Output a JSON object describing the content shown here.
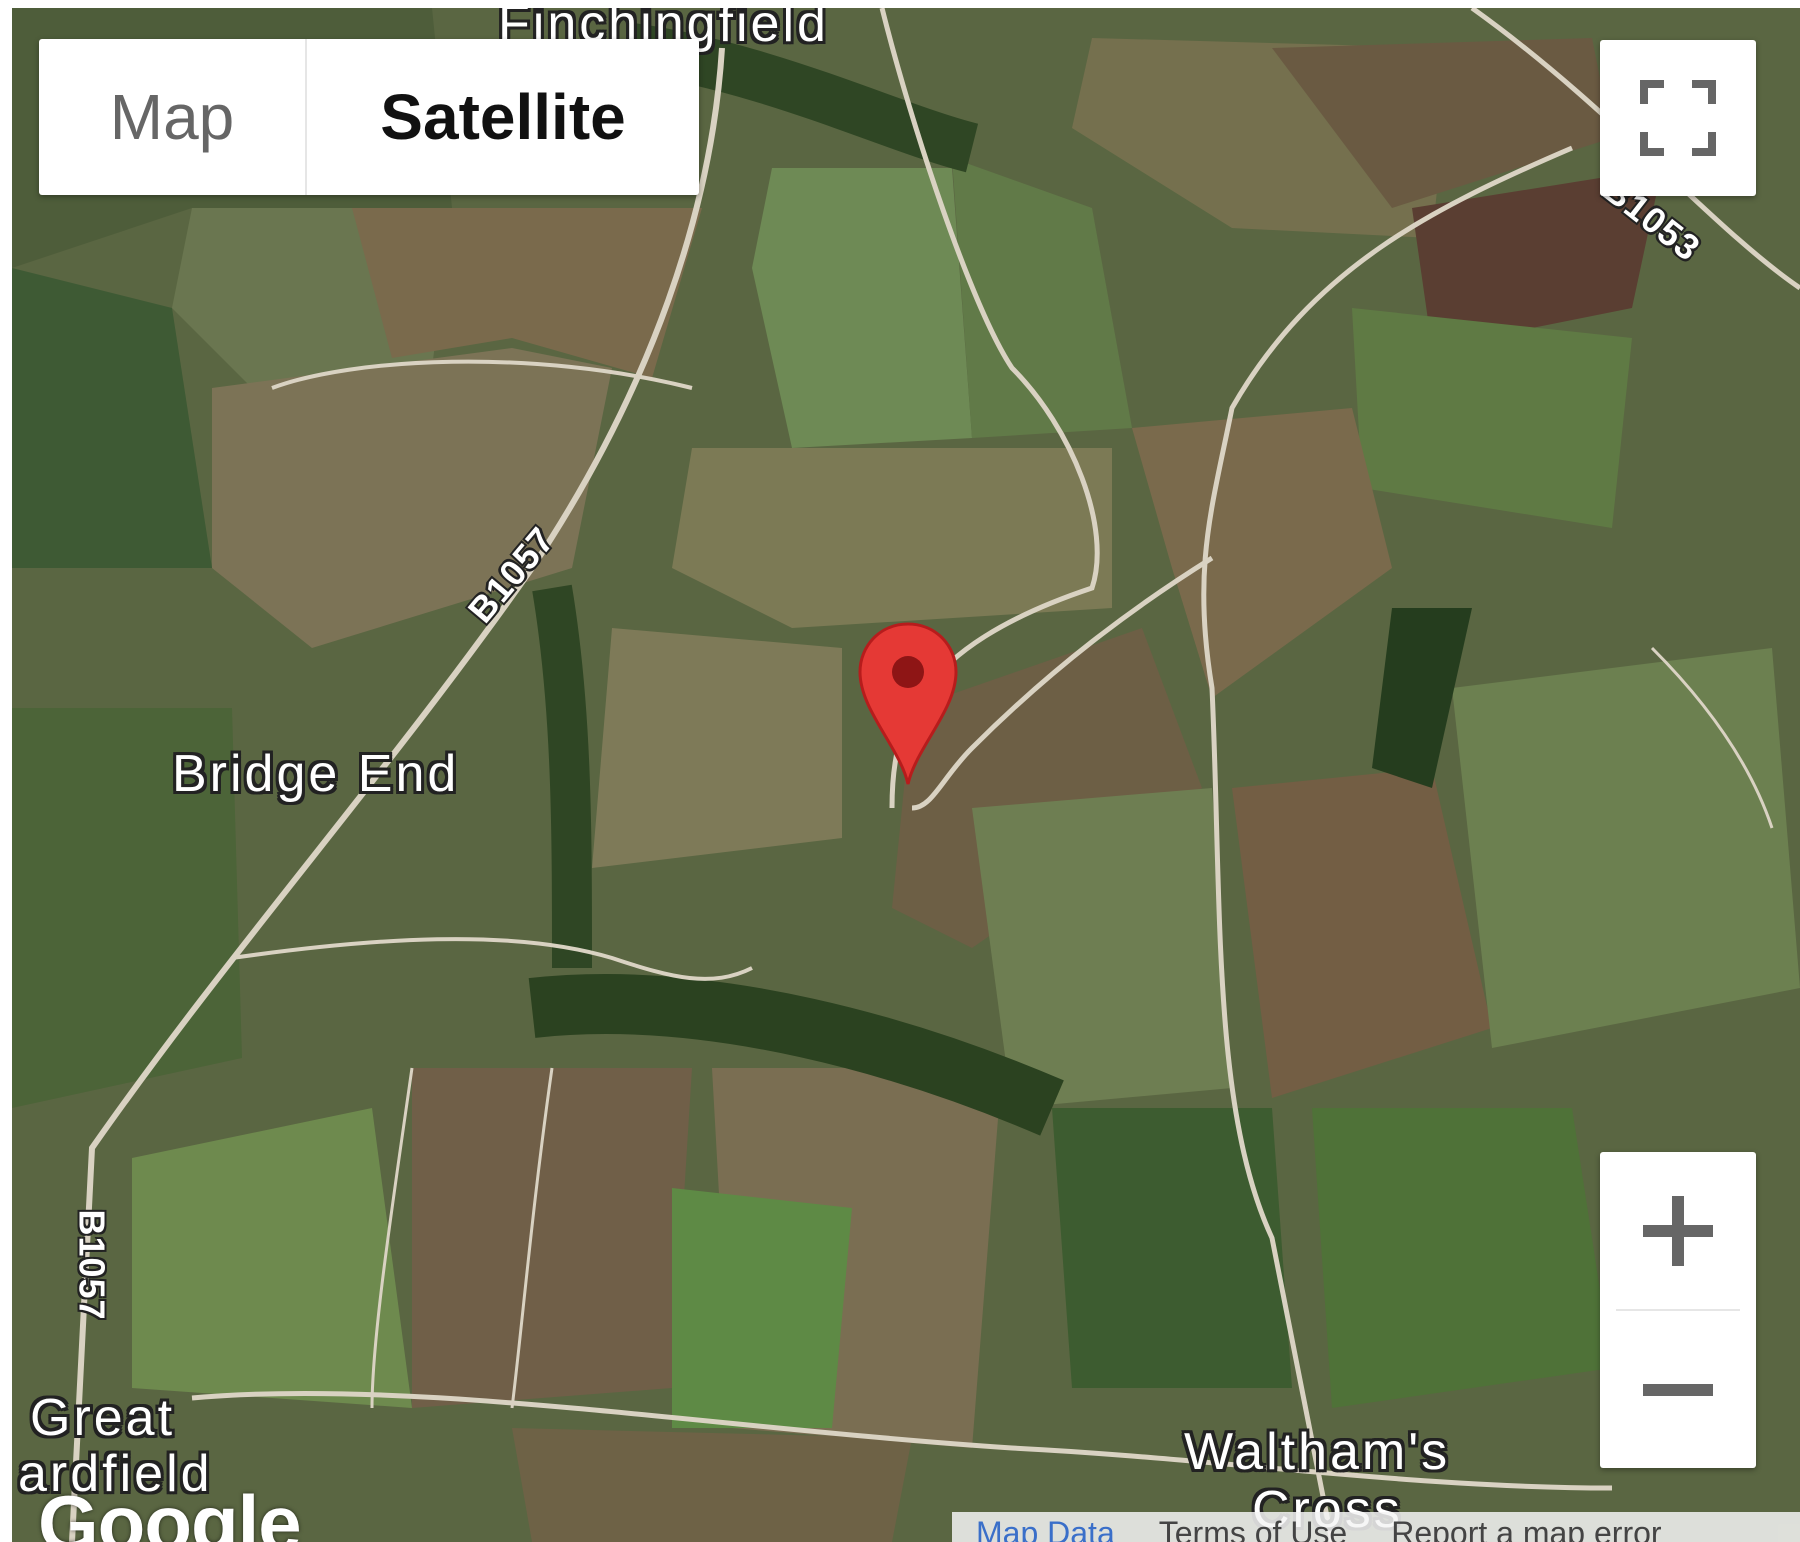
{
  "map_type": {
    "map_label": "Map",
    "satellite_label": "Satellite",
    "selected": "Satellite"
  },
  "places": {
    "finchingfield": "Finchingfield",
    "bridge_end": "Bridge End",
    "great_bardfield_1": "Great",
    "great_bardfield_2": "ardfield",
    "walthams_cross_1": "Waltham's",
    "walthams_cross_2": "Cross"
  },
  "roads": {
    "b1057_a": "B1057",
    "b1057_b": "B1057",
    "b1053": "B1053"
  },
  "branding": "Google",
  "attribution": {
    "map_data": "Map Data",
    "terms": "Terms of Use",
    "report": "Report a map error"
  },
  "icons": {
    "pin": "map-marker-icon",
    "fullscreen": "fullscreen-icon",
    "zoom_in": "plus-icon",
    "zoom_out": "minus-icon"
  },
  "colors": {
    "marker": "#e53935",
    "marker_dot": "#8e1515"
  }
}
